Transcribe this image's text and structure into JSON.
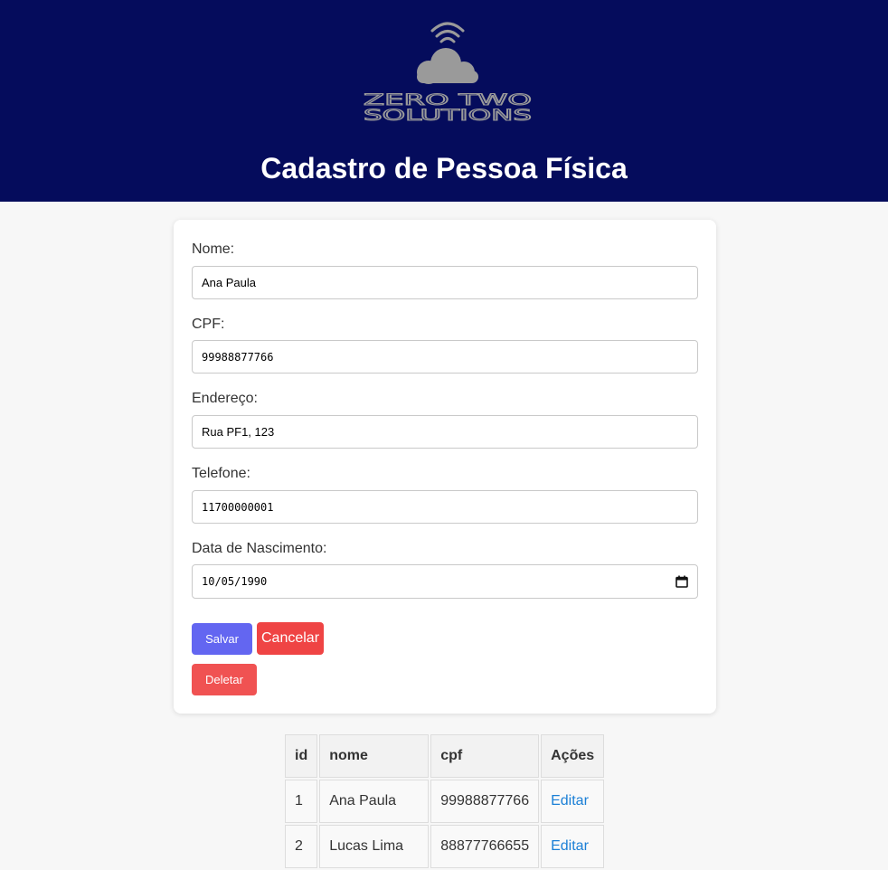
{
  "header": {
    "logo_line1": "ZERO TWO",
    "logo_line2": "SOLUTIONS",
    "title": "Cadastro de Pessoa Física"
  },
  "form": {
    "nome": {
      "label": "Nome:",
      "value": "Ana Paula"
    },
    "cpf": {
      "label": "CPF:",
      "value": "99988877766"
    },
    "endereco": {
      "label": "Endereço:",
      "value": "Rua PF1, 123"
    },
    "telefone": {
      "label": "Telefone:",
      "value": "11700000001"
    },
    "nascimento": {
      "label": "Data de Nascimento:",
      "value": "10/05/1990"
    },
    "buttons": {
      "save": "Salvar",
      "cancel": "Cancelar",
      "delete": "Deletar"
    }
  },
  "table": {
    "headers": [
      "id",
      "nome",
      "cpf",
      "Ações"
    ],
    "rows": [
      {
        "id": "1",
        "nome": "Ana Paula",
        "cpf": "99988877766",
        "action": "Editar"
      },
      {
        "id": "2",
        "nome": "Lucas Lima",
        "cpf": "88877766655",
        "action": "Editar"
      }
    ]
  },
  "colors": {
    "header_bg": "#050c5c",
    "save": "#6366f1",
    "cancel": "#ef4444",
    "delete": "#f05252",
    "link": "#1a7fd6"
  }
}
